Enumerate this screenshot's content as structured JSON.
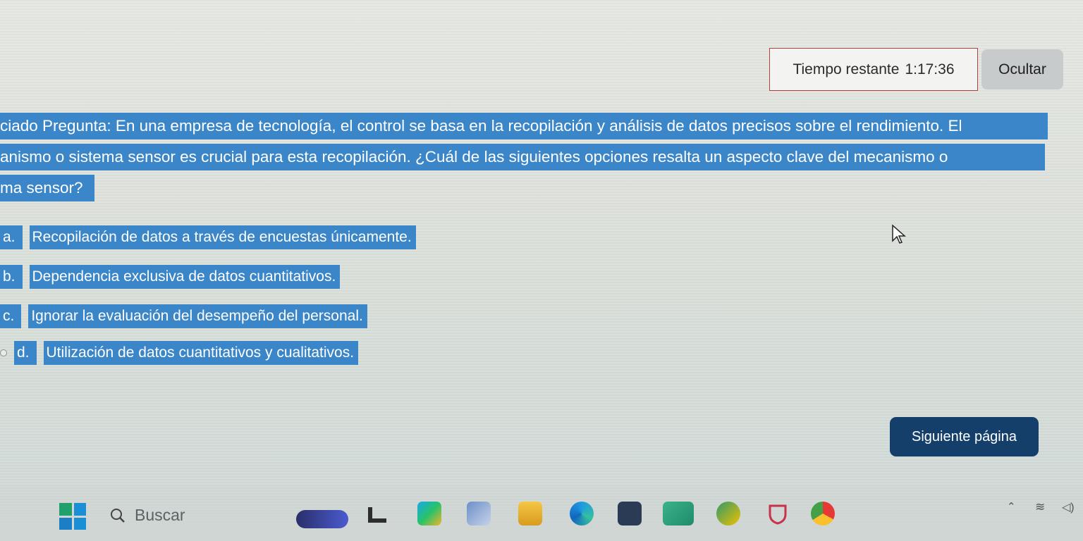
{
  "timer": {
    "label": "Tiempo restante",
    "value": "1:17:36",
    "hide_label": "Ocultar"
  },
  "question": {
    "lines": [
      "ciado Pregunta: En una empresa de tecnología, el control se basa en la recopilación y análisis de datos precisos sobre el rendimiento. El",
      "anismo o sistema sensor es crucial para esta recopilación. ¿Cuál de las siguientes opciones resalta un aspecto clave del mecanismo o",
      "ma sensor?"
    ]
  },
  "options": [
    {
      "letter": "a.",
      "text": "Recopilación de datos a través de encuestas únicamente."
    },
    {
      "letter": "b.",
      "text": "Dependencia exclusiva de datos cuantitativos."
    },
    {
      "letter": "c.",
      "text": "Ignorar la evaluación del desempeño del personal."
    },
    {
      "letter": "d.",
      "text": "Utilización de datos cuantitativos y cualitativos."
    }
  ],
  "next_label": "Siguiente página",
  "taskbar": {
    "search_placeholder": "Buscar",
    "icons": [
      "start-icon",
      "search-icon",
      "weather-icon",
      "task-view-icon",
      "copilot-icon",
      "widgets-icon",
      "file-explorer-icon",
      "edge-icon",
      "store-icon",
      "app-icon",
      "teams-icon",
      "shield-icon",
      "chrome-icon"
    ],
    "tray": [
      "chevron-up-icon",
      "wifi-icon",
      "volume-icon"
    ]
  },
  "colors": {
    "highlight": "#3a86c8",
    "next_button": "#153f6b",
    "timer_border": "#b2403a"
  }
}
